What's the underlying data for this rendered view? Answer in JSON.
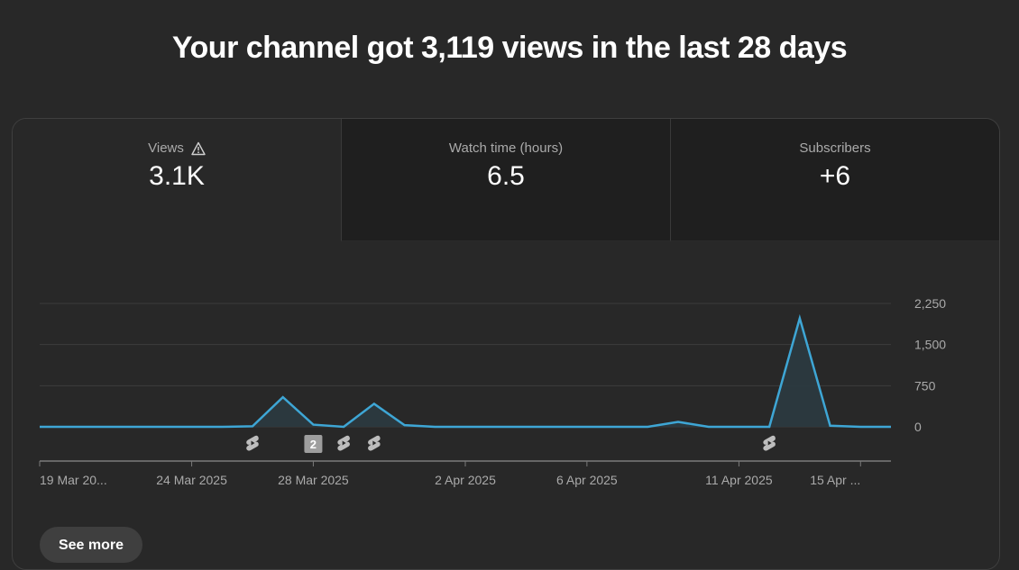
{
  "headline": "Your channel got 3,119 views in the last 28 days",
  "tabs": [
    {
      "label": "Views",
      "value": "3.1K",
      "icon": "warning-icon",
      "active": true
    },
    {
      "label": "Watch time (hours)",
      "value": "6.5",
      "active": false
    },
    {
      "label": "Subscribers",
      "value": "+6",
      "active": false
    }
  ],
  "see_more_label": "See more",
  "colors": {
    "line": "#3ea6d5",
    "fill": "#2b3a40",
    "grid": "#3d3d3d"
  },
  "chart_data": {
    "type": "line",
    "title": "",
    "ylim": [
      0,
      2250
    ],
    "yticks": [
      2250,
      1500,
      750,
      0
    ],
    "ytick_labels": [
      "2,250",
      "1,500",
      "750",
      "0"
    ],
    "x_tick_labels": [
      {
        "label": "19 Mar 20...",
        "index": 0
      },
      {
        "label": "24 Mar 2025",
        "index": 5
      },
      {
        "label": "28 Mar 2025",
        "index": 9
      },
      {
        "label": "2 Apr 2025",
        "index": 14
      },
      {
        "label": "6 Apr 2025",
        "index": 18
      },
      {
        "label": "11 Apr 2025",
        "index": 23
      },
      {
        "label": "15 Apr ...",
        "index": 27
      }
    ],
    "series": [
      {
        "values": [
          0,
          0,
          0,
          0,
          0,
          0,
          0,
          10,
          540,
          40,
          0,
          420,
          30,
          0,
          0,
          0,
          0,
          0,
          0,
          0,
          0,
          90,
          0,
          0,
          0,
          1980,
          20,
          0,
          0
        ]
      }
    ],
    "markers": [
      {
        "index": 7,
        "type": "shorts-icon"
      },
      {
        "index": 9,
        "type": "count-badge",
        "label": "2"
      },
      {
        "index": 10,
        "type": "shorts-icon"
      },
      {
        "index": 11,
        "type": "shorts-icon"
      },
      {
        "index": 24,
        "type": "shorts-icon"
      }
    ]
  }
}
